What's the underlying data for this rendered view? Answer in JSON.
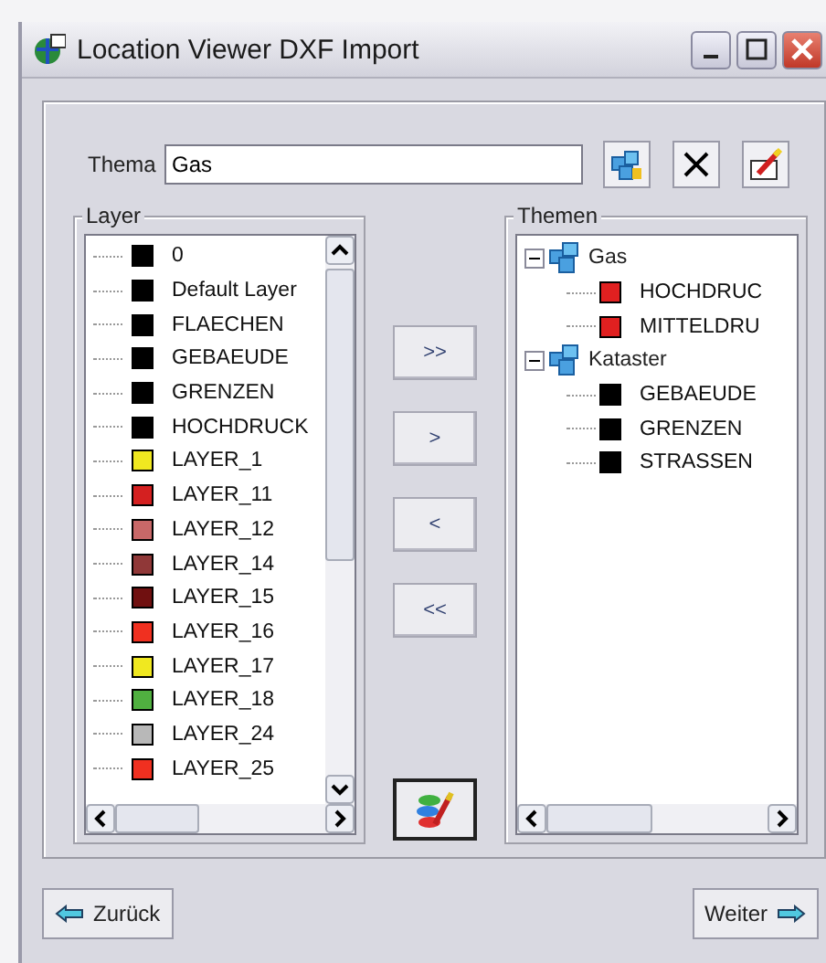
{
  "window": {
    "title": "Location Viewer DXF Import"
  },
  "thema": {
    "label": "Thema",
    "value": "Gas"
  },
  "layer_panel": {
    "title": "Layer",
    "items": [
      {
        "name": "0",
        "color": "#000000"
      },
      {
        "name": "Default Layer",
        "color": "#000000"
      },
      {
        "name": "FLAECHEN",
        "color": "#000000"
      },
      {
        "name": "GEBAEUDE",
        "color": "#000000"
      },
      {
        "name": "GRENZEN",
        "color": "#000000"
      },
      {
        "name": "HOCHDRUCK",
        "color": "#000000"
      },
      {
        "name": "LAYER_1",
        "color": "#f0e820"
      },
      {
        "name": "LAYER_11",
        "color": "#d42020"
      },
      {
        "name": "LAYER_12",
        "color": "#c86868"
      },
      {
        "name": "LAYER_14",
        "color": "#903838"
      },
      {
        "name": "LAYER_15",
        "color": "#701010"
      },
      {
        "name": "LAYER_16",
        "color": "#f03020"
      },
      {
        "name": "LAYER_17",
        "color": "#f0e820"
      },
      {
        "name": "LAYER_18",
        "color": "#50b040"
      },
      {
        "name": "LAYER_24",
        "color": "#b8b8b8"
      },
      {
        "name": "LAYER_25",
        "color": "#f03020"
      }
    ]
  },
  "themen_panel": {
    "title": "Themen",
    "tree": [
      {
        "name": "Gas",
        "expanded": true,
        "children": [
          {
            "name": "HOCHDRUC",
            "color": "#e02020"
          },
          {
            "name": "MITTELDRU",
            "color": "#e02020"
          }
        ]
      },
      {
        "name": "Kataster",
        "expanded": true,
        "children": [
          {
            "name": "GEBAEUDE",
            "color": "#000000"
          },
          {
            "name": "GRENZEN",
            "color": "#000000"
          },
          {
            "name": "STRASSEN",
            "color": "#000000"
          }
        ]
      }
    ]
  },
  "transfer_buttons": [
    ">>",
    ">",
    "<",
    "<<"
  ],
  "navigation": {
    "back": "Zurück",
    "next": "Weiter"
  }
}
